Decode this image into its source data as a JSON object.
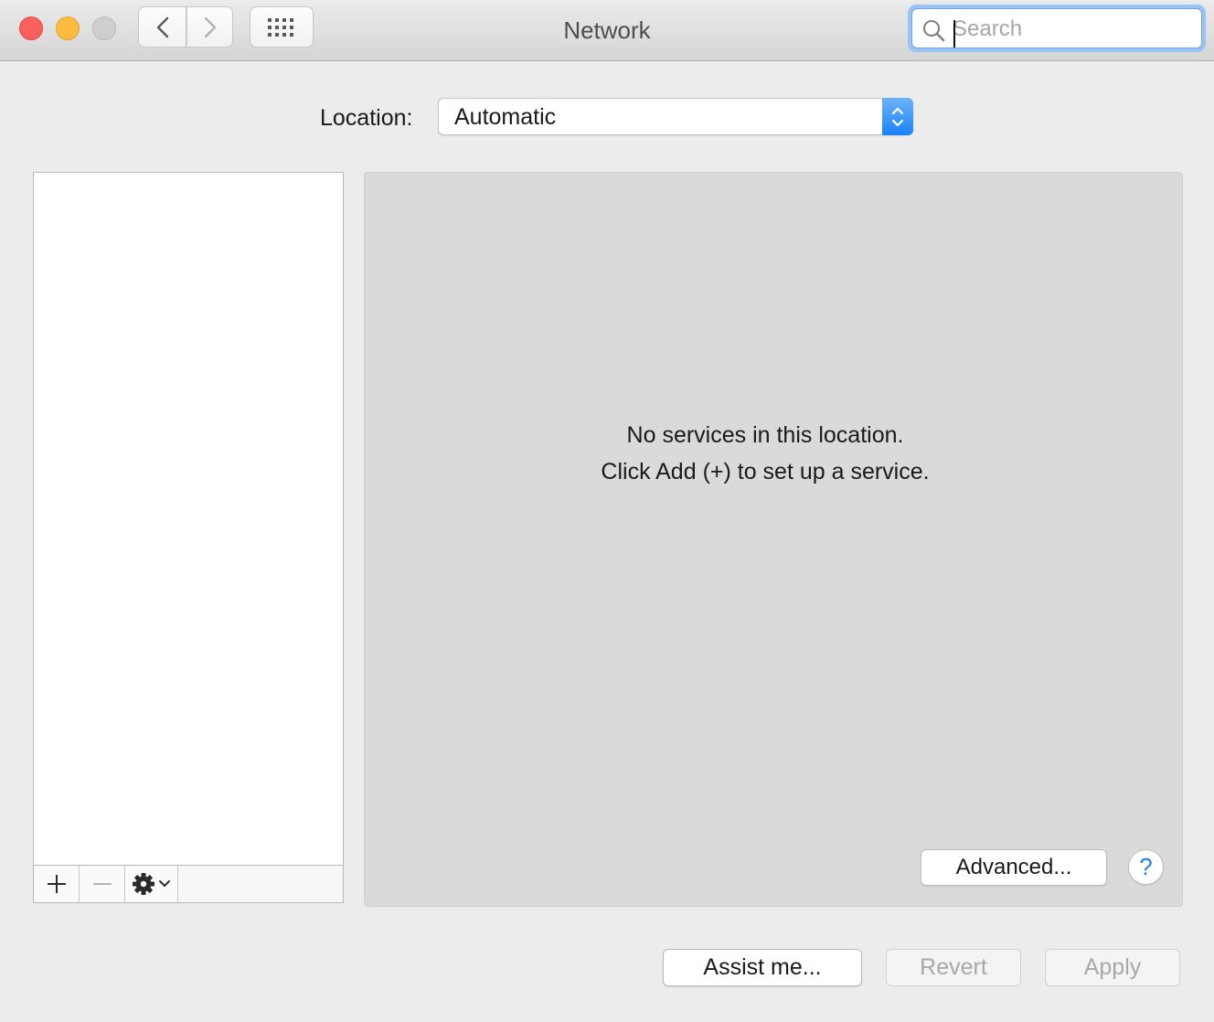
{
  "window": {
    "title": "Network"
  },
  "toolbar": {
    "back_icon": "chevron-left-icon",
    "forward_icon": "chevron-right-icon",
    "show_all_icon": "grid-icon"
  },
  "search": {
    "placeholder": "Search",
    "value": ""
  },
  "location": {
    "label": "Location:",
    "selected": "Automatic"
  },
  "services": {
    "items": [],
    "add_icon": "plus-icon",
    "remove_icon": "minus-icon",
    "action_icon": "gear-icon"
  },
  "detail": {
    "empty_line1": "No services in this location.",
    "empty_line2": "Click Add (+) to set up a service.",
    "advanced_label": "Advanced...",
    "help_label": "?"
  },
  "footer": {
    "assist_label": "Assist me...",
    "revert_label": "Revert",
    "apply_label": "Apply"
  },
  "colors": {
    "accent": "#1a82fb",
    "close": "#fc605c",
    "minimize": "#fdbc40",
    "zoom_disabled": "#cfcfcf",
    "panel_bg": "#dadada",
    "window_bg": "#ececec"
  }
}
